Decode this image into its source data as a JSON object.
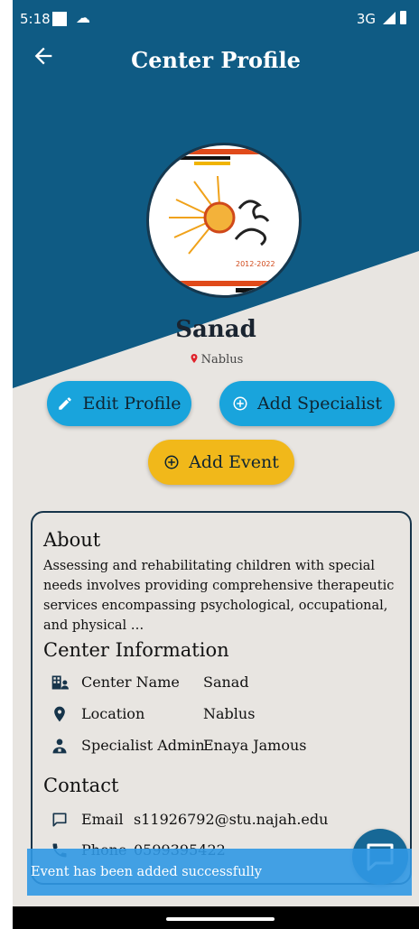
{
  "status_bar": {
    "time": "5:18",
    "network": "3G"
  },
  "app_bar": {
    "title": "Center Profile"
  },
  "profile": {
    "name": "Sanad",
    "location": "Nablus",
    "logo_years": "2012-2022"
  },
  "buttons": {
    "edit_profile": "Edit Profile",
    "add_specialist": "Add Specialist",
    "add_event": "Add Event"
  },
  "about": {
    "heading": "About",
    "text": "Assessing and rehabilitating children with special needs involves providing comprehensive therapeutic services encompassing psychological, occupational, and physical …"
  },
  "center_info": {
    "heading": "Center Information",
    "rows": [
      {
        "icon": "building-person-icon",
        "label": "Center Name",
        "value": "Sanad"
      },
      {
        "icon": "location-pin-icon",
        "label": "Location",
        "value": "Nablus"
      },
      {
        "icon": "person-admin-icon",
        "label": "Specialist Admin",
        "value": "Enaya Jamous"
      }
    ]
  },
  "contact": {
    "heading": "Contact",
    "rows": [
      {
        "icon": "chat-icon",
        "label": "Email",
        "value": "s11926792@stu.najah.edu"
      },
      {
        "icon": "phone-icon",
        "label": "Phone",
        "value": "0599395422"
      }
    ]
  },
  "snackbar": {
    "message": "Event has been added successfully"
  },
  "colors": {
    "header_blue": "#0f5b84",
    "background": "#e8e5e1",
    "button_blue": "#19a4dc",
    "button_yellow": "#f1b81a",
    "card_border": "#16344a",
    "snackbar": "#3098e4"
  }
}
